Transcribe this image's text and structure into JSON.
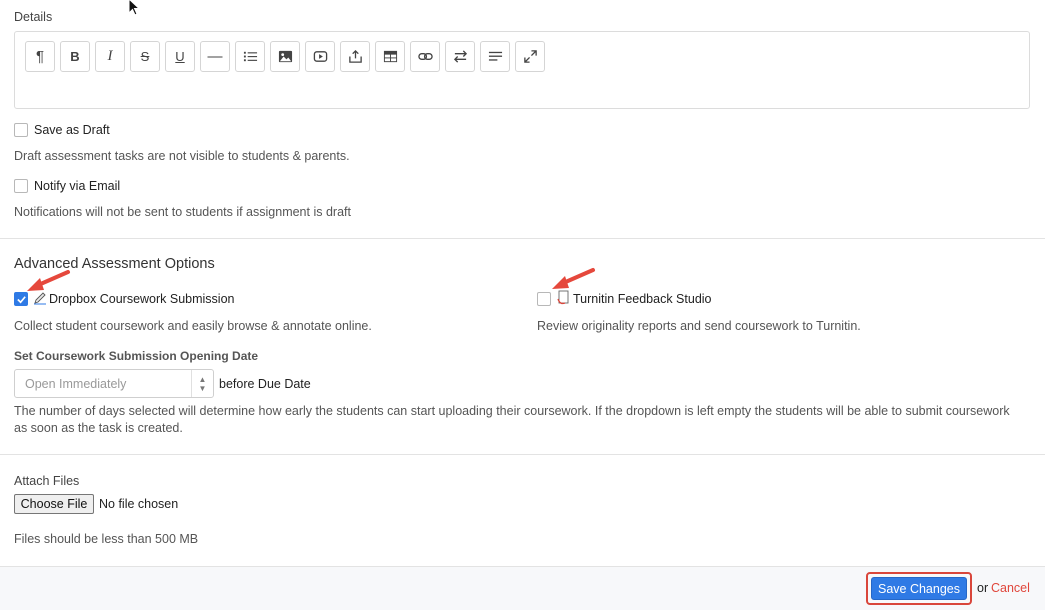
{
  "details": {
    "label": "Details",
    "toolbar": [
      {
        "name": "paragraph-icon",
        "glyph": "¶"
      },
      {
        "name": "bold-icon",
        "glyph": "B"
      },
      {
        "name": "italic-icon",
        "glyph": "I"
      },
      {
        "name": "strikethrough-icon",
        "glyph": "S"
      },
      {
        "name": "underline-icon",
        "glyph": "U"
      },
      {
        "name": "horizontal-rule-icon",
        "glyph": "—"
      },
      {
        "name": "list-icon",
        "glyph": ""
      },
      {
        "name": "image-icon",
        "glyph": ""
      },
      {
        "name": "video-icon",
        "glyph": ""
      },
      {
        "name": "upload-icon",
        "glyph": ""
      },
      {
        "name": "table-icon",
        "glyph": ""
      },
      {
        "name": "link-icon",
        "glyph": ""
      },
      {
        "name": "swap-icon",
        "glyph": ""
      },
      {
        "name": "align-icon",
        "glyph": ""
      },
      {
        "name": "fullscreen-icon",
        "glyph": ""
      }
    ]
  },
  "draft": {
    "label": "Save as Draft",
    "help": "Draft assessment tasks are not visible to students & parents.",
    "checked": false
  },
  "notify": {
    "label": "Notify via Email",
    "help": "Notifications will not be sent to students if assignment is draft",
    "checked": false
  },
  "advanced": {
    "title": "Advanced Assessment Options",
    "dropbox": {
      "label": "Dropbox Coursework Submission",
      "help": "Collect student coursework and easily browse & annotate online.",
      "checked": true
    },
    "turnitin": {
      "label": "Turnitin Feedback Studio",
      "help": "Review originality reports and send coursework to Turnitin.",
      "checked": false
    },
    "opening_date": {
      "label": "Set Coursework Submission Opening Date",
      "placeholder": "Open Immediately",
      "suffix": "before Due Date",
      "help": "The number of days selected will determine how early the students can start uploading their coursework. If the dropdown is left empty the students will be able to submit coursework as soon as the task is created."
    }
  },
  "attach": {
    "label": "Attach Files",
    "button": "Choose File",
    "status": "No file chosen",
    "help": "Files should be less than 500 MB"
  },
  "footer": {
    "save_label": "Save Changes",
    "or_text": "or",
    "cancel_label": "Cancel"
  },
  "colors": {
    "accent": "#2f7ae5",
    "highlight": "#d9463b",
    "cancel": "#e0463b"
  }
}
